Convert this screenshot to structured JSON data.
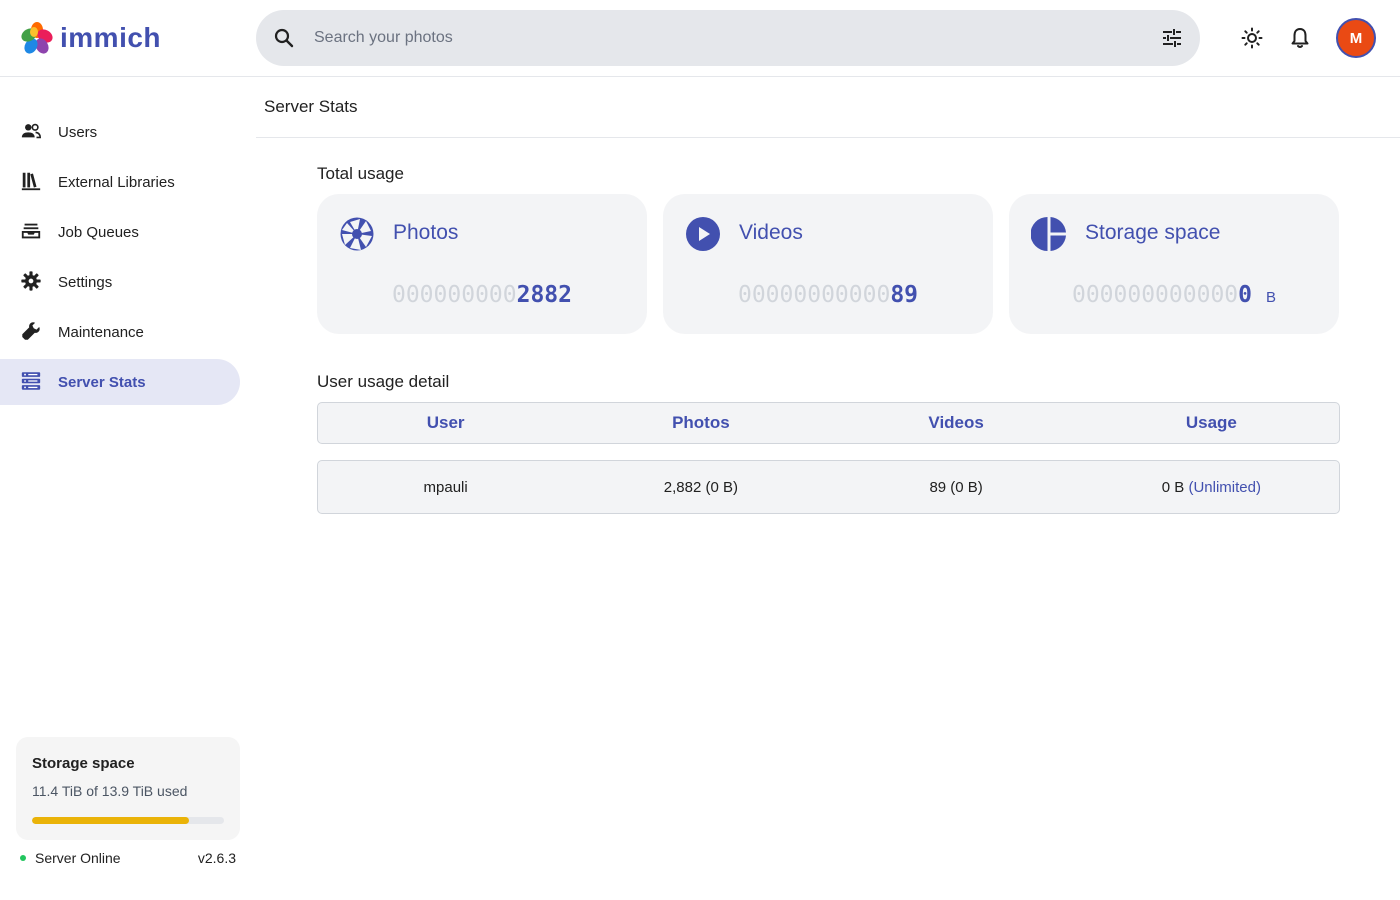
{
  "app": {
    "name": "immich"
  },
  "search": {
    "placeholder": "Search your photos"
  },
  "user": {
    "initial": "M"
  },
  "sidebar": {
    "items": [
      {
        "label": "Users",
        "icon": "users-icon",
        "active": false
      },
      {
        "label": "External Libraries",
        "icon": "library-shelves-icon",
        "active": false
      },
      {
        "label": "Job Queues",
        "icon": "tray-stack-icon",
        "active": false
      },
      {
        "label": "Settings",
        "icon": "gear-icon",
        "active": false
      },
      {
        "label": "Maintenance",
        "icon": "wrench-icon",
        "active": false
      },
      {
        "label": "Server Stats",
        "icon": "server-icon",
        "active": true
      }
    ],
    "storage": {
      "title": "Storage space",
      "used_text": "11.4 TiB of 13.9 TiB used",
      "used_fraction": 0.82
    },
    "server": {
      "status": "Server Online",
      "version": "v2.6.3"
    }
  },
  "page": {
    "title": "Server Stats"
  },
  "total_usage": {
    "title": "Total usage",
    "cards": [
      {
        "label": "Photos",
        "pad": "000000000",
        "value": "2882",
        "unit": "",
        "icon": "camera-iris-icon"
      },
      {
        "label": "Videos",
        "pad": "00000000000",
        "value": "89",
        "unit": "",
        "icon": "play-circle-icon"
      },
      {
        "label": "Storage space",
        "pad": "000000000000",
        "value": "0",
        "unit": "B",
        "icon": "chart-pie-icon"
      }
    ]
  },
  "user_usage": {
    "title": "User usage detail",
    "headers": [
      "User",
      "Photos",
      "Videos",
      "Usage"
    ],
    "rows": [
      {
        "user": "mpauli",
        "photos": "2,882 (0 B)",
        "videos": "89 (0 B)",
        "usage": "0 B",
        "limit": "(Unlimited)"
      }
    ]
  },
  "colors": {
    "primary": "#4250af",
    "avatar": "#ea4a14",
    "storage_bar": "#eab308",
    "online": "#22c55e"
  }
}
